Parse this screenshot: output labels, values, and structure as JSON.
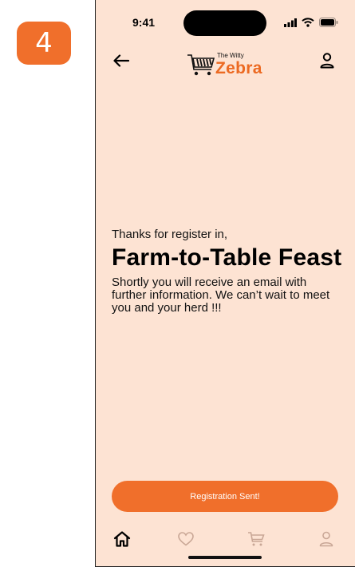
{
  "step_badge": "4",
  "status_bar": {
    "time": "9:41",
    "icons": [
      "signal-icon",
      "wifi-icon",
      "battery-icon"
    ]
  },
  "header": {
    "back_icon": "arrow-left-icon",
    "logo": {
      "small_text": "The Witty",
      "big_text": "Zebra",
      "icon": "shopping-cart-icon"
    },
    "profile_icon": "user-icon"
  },
  "content": {
    "lead": "Thanks  for register in,",
    "event_title": "Farm-to-Table Feast",
    "message": "Shortly you will receive an email with further information. We can’t wait to meet you and your herd !!!"
  },
  "cta": {
    "label": "Registration Sent!"
  },
  "tabbar": {
    "items": [
      {
        "icon": "home-icon",
        "active": true
      },
      {
        "icon": "heart-icon",
        "active": false
      },
      {
        "icon": "cart-icon",
        "active": false
      },
      {
        "icon": "user-icon",
        "active": false
      }
    ]
  },
  "colors": {
    "accent": "#f06f2b",
    "background": "#fde3d3",
    "brand_text": "#ec6a22",
    "inactive_icon": "#c9a796"
  }
}
